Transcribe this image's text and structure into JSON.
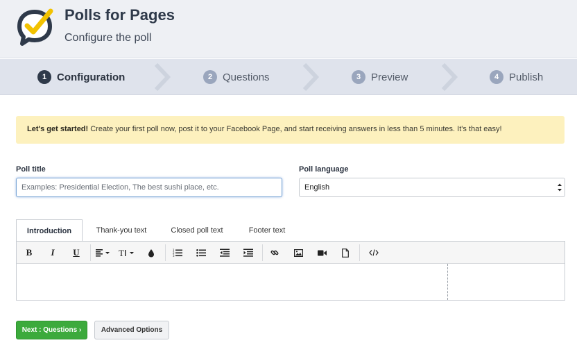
{
  "header": {
    "title": "Polls for Pages",
    "subtitle": "Configure the poll",
    "logo_icon": "speech-bubble-checkmark-icon",
    "logo_colors": {
      "bubble": "#2f3a4a",
      "check": "#f2c200"
    }
  },
  "steps": [
    {
      "number": "1",
      "label": "Configuration",
      "active": true
    },
    {
      "number": "2",
      "label": "Questions",
      "active": false
    },
    {
      "number": "3",
      "label": "Preview",
      "active": false
    },
    {
      "number": "4",
      "label": "Publish",
      "active": false
    }
  ],
  "alert": {
    "bold": "Let's get started!",
    "text": " Create your first poll now, post it to your Facebook Page, and start receiving answers in less than 5 minutes. It's that easy!"
  },
  "form": {
    "poll_title_label": "Poll title",
    "poll_title_value": "",
    "poll_title_placeholder": "Examples: Presidential Election, The best sushi place, etc.",
    "poll_language_label": "Poll language",
    "poll_language_value": "English"
  },
  "tabs": [
    {
      "label": "Introduction",
      "active": true
    },
    {
      "label": "Thank-you text",
      "active": false
    },
    {
      "label": "Closed poll text",
      "active": false
    },
    {
      "label": "Footer text",
      "active": false
    }
  ],
  "toolbar": {
    "bold": "B",
    "italic": "I",
    "underline": "U",
    "icons": [
      "bold-icon",
      "italic-icon",
      "underline-icon",
      "align-icon",
      "text-size-icon",
      "color-drop-icon",
      "ordered-list-icon",
      "unordered-list-icon",
      "outdent-icon",
      "indent-icon",
      "link-icon",
      "image-icon",
      "video-icon",
      "file-icon",
      "code-view-icon"
    ]
  },
  "buttons": {
    "next": "Next : Questions ›",
    "advanced": "Advanced Options"
  },
  "colors": {
    "accent_green": "#3caa3c",
    "alert_bg": "#fdf1be",
    "header_bg": "#eef0f4",
    "steps_bg": "#dfe3ec",
    "step_badge": "#9aa6bd"
  }
}
